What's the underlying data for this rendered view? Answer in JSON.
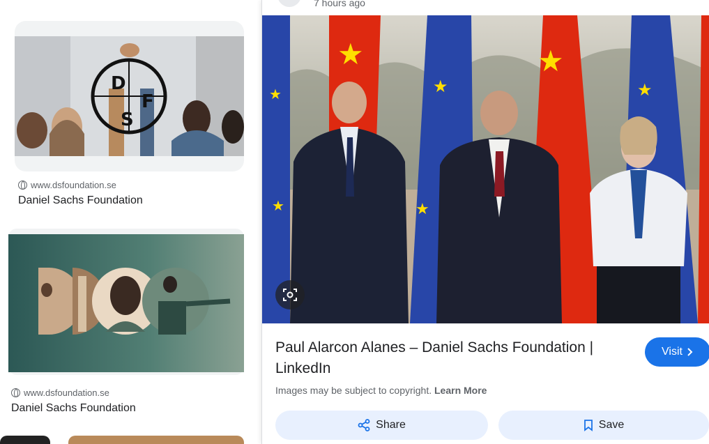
{
  "results": [
    {
      "source": "www.dsfoundation.se",
      "title": "Daniel Sachs Foundation",
      "logo": "D S F"
    },
    {
      "source": "www.dsfoundation.se",
      "title": "Daniel Sachs Foundation"
    }
  ],
  "panel": {
    "timestamp": "7 hours ago",
    "title": "Paul Alarcon Alanes – Daniel Sachs Foundation | LinkedIn",
    "visit_label": "Visit",
    "copyright_text": "Images may be subject to copyright.",
    "learn_more": "Learn More",
    "share_label": "Share",
    "save_label": "Save"
  },
  "colors": {
    "accent": "#1a73e8",
    "button_bg": "#e8f0fe",
    "flag_red": "#de2910",
    "flag_blue": "#2846a8",
    "star_yellow": "#ffde00"
  }
}
